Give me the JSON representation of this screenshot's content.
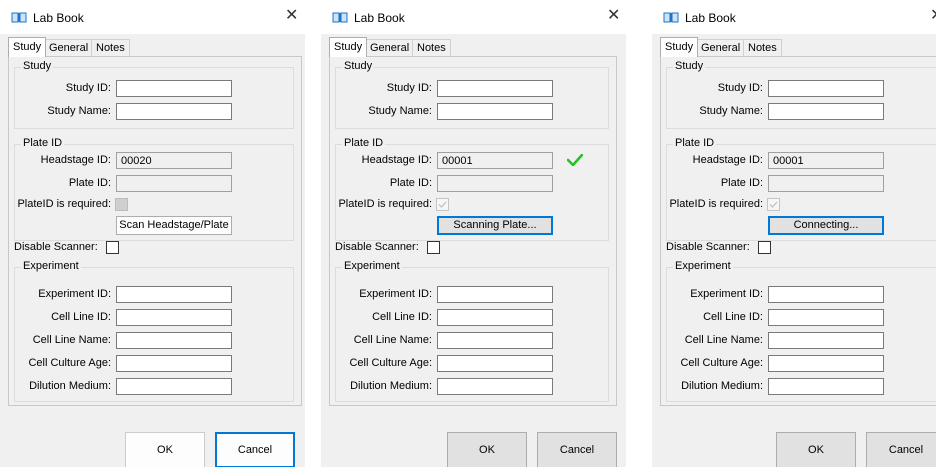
{
  "windows": [
    {
      "title": "Lab Book",
      "tabs": [
        "Study",
        "General",
        "Notes"
      ],
      "study_group": {
        "title": "Study",
        "study_id_label": "Study ID:",
        "study_id_value": "",
        "study_name_label": "Study Name:",
        "study_name_value": ""
      },
      "plate_group": {
        "title": "Plate ID",
        "headstage_id_label": "Headstage ID:",
        "headstage_id_value": "00020",
        "plate_id_label": "Plate ID:",
        "plate_id_value": "",
        "plate_required_label": "PlateID is required:",
        "plate_required_checked": true,
        "scan_button_label": "Scan Headstage/Plate",
        "checkmark_visible": false
      },
      "disable_scanner_label": "Disable Scanner:",
      "experiment_group": {
        "title": "Experiment",
        "experiment_id_label": "Experiment ID:",
        "cell_line_id_label": "Cell Line ID:",
        "cell_line_name_label": "Cell Line Name:",
        "cell_culture_age_label": "Cell Culture Age:",
        "dilution_medium_label": "Dilution Medium:"
      },
      "ok_label": "OK",
      "cancel_label": "Cancel"
    },
    {
      "title": "Lab Book",
      "tabs": [
        "Study",
        "General",
        "Notes"
      ],
      "study_group": {
        "title": "Study",
        "study_id_label": "Study ID:",
        "study_id_value": "",
        "study_name_label": "Study Name:",
        "study_name_value": ""
      },
      "plate_group": {
        "title": "Plate ID",
        "headstage_id_label": "Headstage ID:",
        "headstage_id_value": "00001",
        "plate_id_label": "Plate ID:",
        "plate_id_value": "",
        "plate_required_label": "PlateID is required:",
        "plate_required_checked": true,
        "scan_button_label": "Scanning Plate...",
        "checkmark_visible": true
      },
      "disable_scanner_label": "Disable Scanner:",
      "experiment_group": {
        "title": "Experiment",
        "experiment_id_label": "Experiment ID:",
        "cell_line_id_label": "Cell Line ID:",
        "cell_line_name_label": "Cell Line Name:",
        "cell_culture_age_label": "Cell Culture Age:",
        "dilution_medium_label": "Dilution Medium:"
      },
      "ok_label": "OK",
      "cancel_label": "Cancel"
    },
    {
      "title": "Lab Book",
      "tabs": [
        "Study",
        "General",
        "Notes"
      ],
      "study_group": {
        "title": "Study",
        "study_id_label": "Study ID:",
        "study_id_value": "",
        "study_name_label": "Study Name:",
        "study_name_value": ""
      },
      "plate_group": {
        "title": "Plate ID",
        "headstage_id_label": "Headstage ID:",
        "headstage_id_value": "00001",
        "plate_id_label": "Plate ID:",
        "plate_id_value": "",
        "plate_required_label": "PlateID is required:",
        "plate_required_checked": true,
        "scan_button_label": "Connecting...",
        "checkmark_visible": false
      },
      "disable_scanner_label": "Disable Scanner:",
      "experiment_group": {
        "title": "Experiment",
        "experiment_id_label": "Experiment ID:",
        "cell_line_id_label": "Cell Line ID:",
        "cell_line_name_label": "Cell Line Name:",
        "cell_culture_age_label": "Cell Culture Age:",
        "dilution_medium_label": "Dilution Medium:"
      },
      "ok_label": "OK",
      "cancel_label": "Cancel"
    }
  ],
  "colors": {
    "accent": "#0078d7",
    "checkmark": "#22c322",
    "dialog_bg": "#f0f0f0",
    "titlebar_bg": "#ffffff"
  },
  "icons": {
    "app": "book-icon",
    "close": "close-icon",
    "checkmark": "checkmark-icon"
  }
}
